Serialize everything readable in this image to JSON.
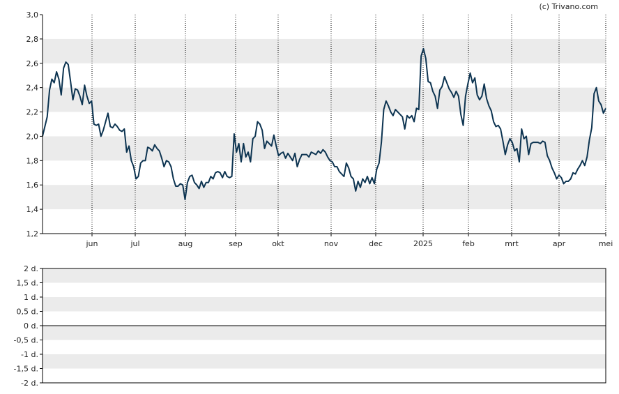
{
  "credit": "(c) Trivano.com",
  "colors": {
    "line": "#0d3451",
    "band": "#ebebeb",
    "axis": "#000000",
    "grid_vertical": "#000000",
    "zero_line": "#000000"
  },
  "chart_data": [
    {
      "type": "line",
      "title": "",
      "xlabel": "",
      "ylabel": "",
      "ylim": [
        1.2,
        3.0
      ],
      "y_ticks": [
        "3,0",
        "2,8",
        "2,6",
        "2,4",
        "2,2",
        "2,0",
        "1,8",
        "1,6",
        "1,4",
        "1,2"
      ],
      "x_ticks": [
        "jun",
        "jul",
        "aug",
        "sep",
        "okt",
        "nov",
        "dec",
        "2025",
        "feb",
        "mrt",
        "apr",
        "mei"
      ],
      "grid": "horizontal alternating bands, dotted vertical lines at month ticks",
      "series": [
        {
          "values": [
            2.0,
            2.08,
            2.16,
            2.38,
            2.47,
            2.44,
            2.53,
            2.47,
            2.34,
            2.56,
            2.61,
            2.59,
            2.45,
            2.3,
            2.39,
            2.38,
            2.33,
            2.26,
            2.42,
            2.33,
            2.27,
            2.29,
            2.1,
            2.09,
            2.1,
            2.0,
            2.05,
            2.12,
            2.19,
            2.08,
            2.07,
            2.1,
            2.08,
            2.05,
            2.04,
            2.06,
            1.87,
            1.92,
            1.8,
            1.75,
            1.65,
            1.67,
            1.78,
            1.8,
            1.8,
            1.91,
            1.9,
            1.88,
            1.93,
            1.9,
            1.88,
            1.82,
            1.75,
            1.8,
            1.79,
            1.75,
            1.65,
            1.59,
            1.59,
            1.61,
            1.6,
            1.48,
            1.62,
            1.67,
            1.68,
            1.62,
            1.6,
            1.57,
            1.63,
            1.58,
            1.62,
            1.62,
            1.67,
            1.65,
            1.7,
            1.71,
            1.7,
            1.66,
            1.71,
            1.67,
            1.66,
            1.67,
            2.02,
            1.87,
            1.94,
            1.79,
            1.94,
            1.83,
            1.87,
            1.79,
            1.98,
            2.0,
            2.12,
            2.1,
            2.05,
            1.9,
            1.96,
            1.94,
            1.92,
            2.01,
            1.92,
            1.84,
            1.86,
            1.87,
            1.82,
            1.86,
            1.83,
            1.8,
            1.86,
            1.75,
            1.81,
            1.85,
            1.85,
            1.85,
            1.83,
            1.87,
            1.86,
            1.85,
            1.88,
            1.86,
            1.89,
            1.87,
            1.83,
            1.8,
            1.79,
            1.75,
            1.75,
            1.71,
            1.69,
            1.67,
            1.78,
            1.74,
            1.67,
            1.65,
            1.55,
            1.63,
            1.58,
            1.65,
            1.62,
            1.67,
            1.61,
            1.66,
            1.61,
            1.73,
            1.78,
            1.95,
            2.22,
            2.29,
            2.25,
            2.2,
            2.17,
            2.22,
            2.2,
            2.18,
            2.16,
            2.06,
            2.17,
            2.15,
            2.17,
            2.12,
            2.23,
            2.22,
            2.66,
            2.72,
            2.64,
            2.45,
            2.44,
            2.37,
            2.33,
            2.23,
            2.38,
            2.41,
            2.49,
            2.44,
            2.39,
            2.36,
            2.32,
            2.37,
            2.33,
            2.18,
            2.09,
            2.33,
            2.43,
            2.52,
            2.44,
            2.48,
            2.34,
            2.3,
            2.33,
            2.43,
            2.31,
            2.25,
            2.21,
            2.12,
            2.08,
            2.09,
            2.06,
            1.96,
            1.85,
            1.93,
            1.98,
            1.95,
            1.88,
            1.9,
            1.79,
            2.06,
            1.98,
            2.0,
            1.85,
            1.94,
            1.95,
            1.95,
            1.95,
            1.94,
            1.96,
            1.95,
            1.84,
            1.8,
            1.74,
            1.7,
            1.65,
            1.68,
            1.66,
            1.61,
            1.63,
            1.63,
            1.65,
            1.7,
            1.69,
            1.73,
            1.76,
            1.8,
            1.76,
            1.83,
            1.97,
            2.07,
            2.35,
            2.4,
            2.29,
            2.26,
            2.19,
            2.23
          ]
        }
      ]
    },
    {
      "type": "line",
      "title": "",
      "xlabel": "",
      "ylabel": "",
      "ylim": [
        -2,
        2
      ],
      "y_ticks": [
        "2 d.",
        "1,5 d.",
        "1 d.",
        "0,5 d.",
        "0 d.",
        "-0,5 d.",
        "-1 d.",
        "-1,5 d.",
        "-2 d."
      ],
      "grid": "horizontal alternating bands, solid zero line",
      "series": []
    }
  ]
}
